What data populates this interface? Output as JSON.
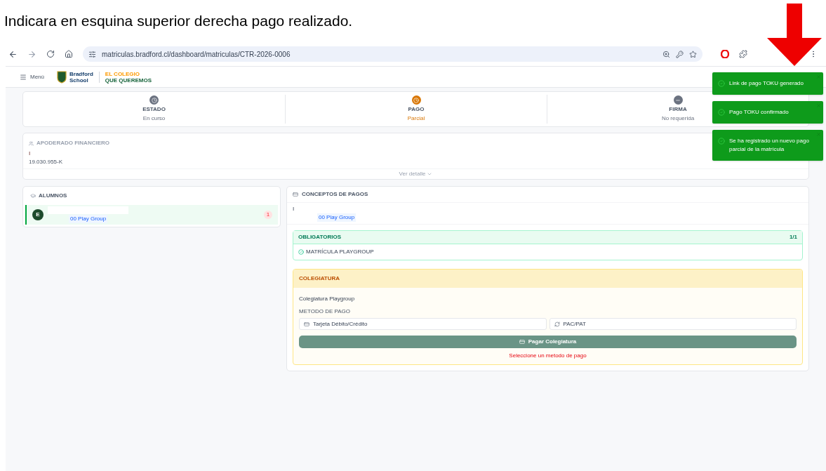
{
  "caption": "Indicara en esquina superior derecha pago realizado.",
  "browser": {
    "url": "matriculas.bradford.cl/dashboard/matriculas/CTR-2026-0006"
  },
  "header": {
    "menu_label": "Menú",
    "logo_line_1": "Bradford",
    "logo_line_2": "School",
    "slogan_line_1": "EL COLEGIO",
    "slogan_line_2": "QUE QUEREMOS"
  },
  "status_steps": [
    {
      "kind": "clock",
      "label": "ESTADO",
      "value": "En curso",
      "color": "#6b7280"
    },
    {
      "kind": "clock",
      "label": "PAGO",
      "value": "Parcial",
      "color": "#d97706"
    },
    {
      "kind": "minus",
      "label": "FIRMA",
      "value": "No requerida",
      "color": "#6b7280"
    }
  ],
  "guardian": {
    "title": "APODERADO FINANCIERO",
    "name": "I",
    "rut": "19.030.955-K",
    "more_link": "Ver detalle"
  },
  "students": {
    "title": "ALUMNOS",
    "items": [
      {
        "initial": "E",
        "course": "00 Play Group",
        "badge": "1",
        "selected": true
      }
    ]
  },
  "payments": {
    "title": "CONCEPTOS DE PAGOS",
    "student_name": "I",
    "course": "00 Play Group",
    "mandatory": {
      "title": "OBLIGATORIOS",
      "count": "1/1",
      "items": [
        {
          "name": "MATRÍCULA PLAYGROUP"
        }
      ]
    },
    "tuition": {
      "title": "COLEGIATURA",
      "item_name": "Colegiatura Playgroup",
      "method_label": "METODO DE PAGO",
      "methods": [
        {
          "kind": "card",
          "label": "Tarjeta Débito/Crédito",
          "selected": false
        },
        {
          "kind": "recurring",
          "label": "PAC/PAT",
          "selected": false
        }
      ],
      "pay_button": "Pagar Colegiatura",
      "error": "Seleccione un metodo de pago"
    }
  },
  "toasts": [
    {
      "message": "Link de pago TOKU generado"
    },
    {
      "message": "Pago TOKU confirmado"
    },
    {
      "message": "Se ha registrado un nuevo pago parcial de la matrícula"
    }
  ]
}
